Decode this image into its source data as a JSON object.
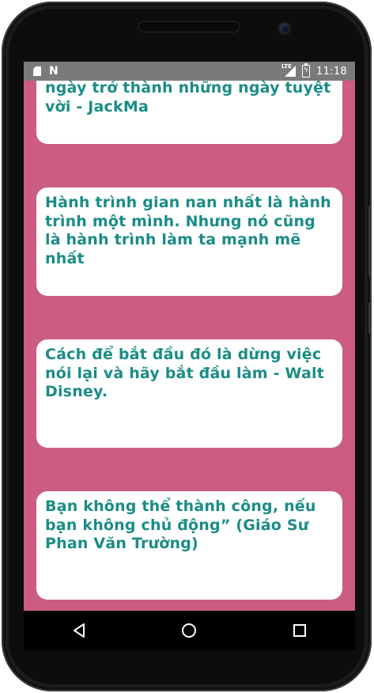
{
  "status_bar": {
    "time": "11:18",
    "network_label": "LTE",
    "left_icons": [
      "sd-card-icon",
      "n-notification-icon"
    ],
    "right_icons": [
      "signal-icon",
      "battery-charging-icon"
    ]
  },
  "theme": {
    "background": "#cd5c84",
    "card_background": "#ffffff",
    "quote_text_color": "#1a8c86",
    "status_bar_color": "#7a7a7a"
  },
  "quotes": [
    {
      "text": "Khó khăn lớn nhất của những người thành công là biến mỗi ngày trở thành những ngày tuyệt vời - JackMa"
    },
    {
      "text": "Hành trình gian nan nhất là hành trình một mình. Nhưng nó cũng là hành trình làm ta mạnh mẽ nhất"
    },
    {
      "text": "Cách để bắt đầu đó là dừng việc nói lại và hãy bắt đầu làm - Walt Disney."
    },
    {
      "text": "Bạn không thể thành công, nếu bạn không chủ động” (Giáo Sư Phan Văn Trường)"
    }
  ],
  "nav_bar": {
    "icons": [
      "back-icon",
      "home-icon",
      "recents-icon"
    ]
  }
}
